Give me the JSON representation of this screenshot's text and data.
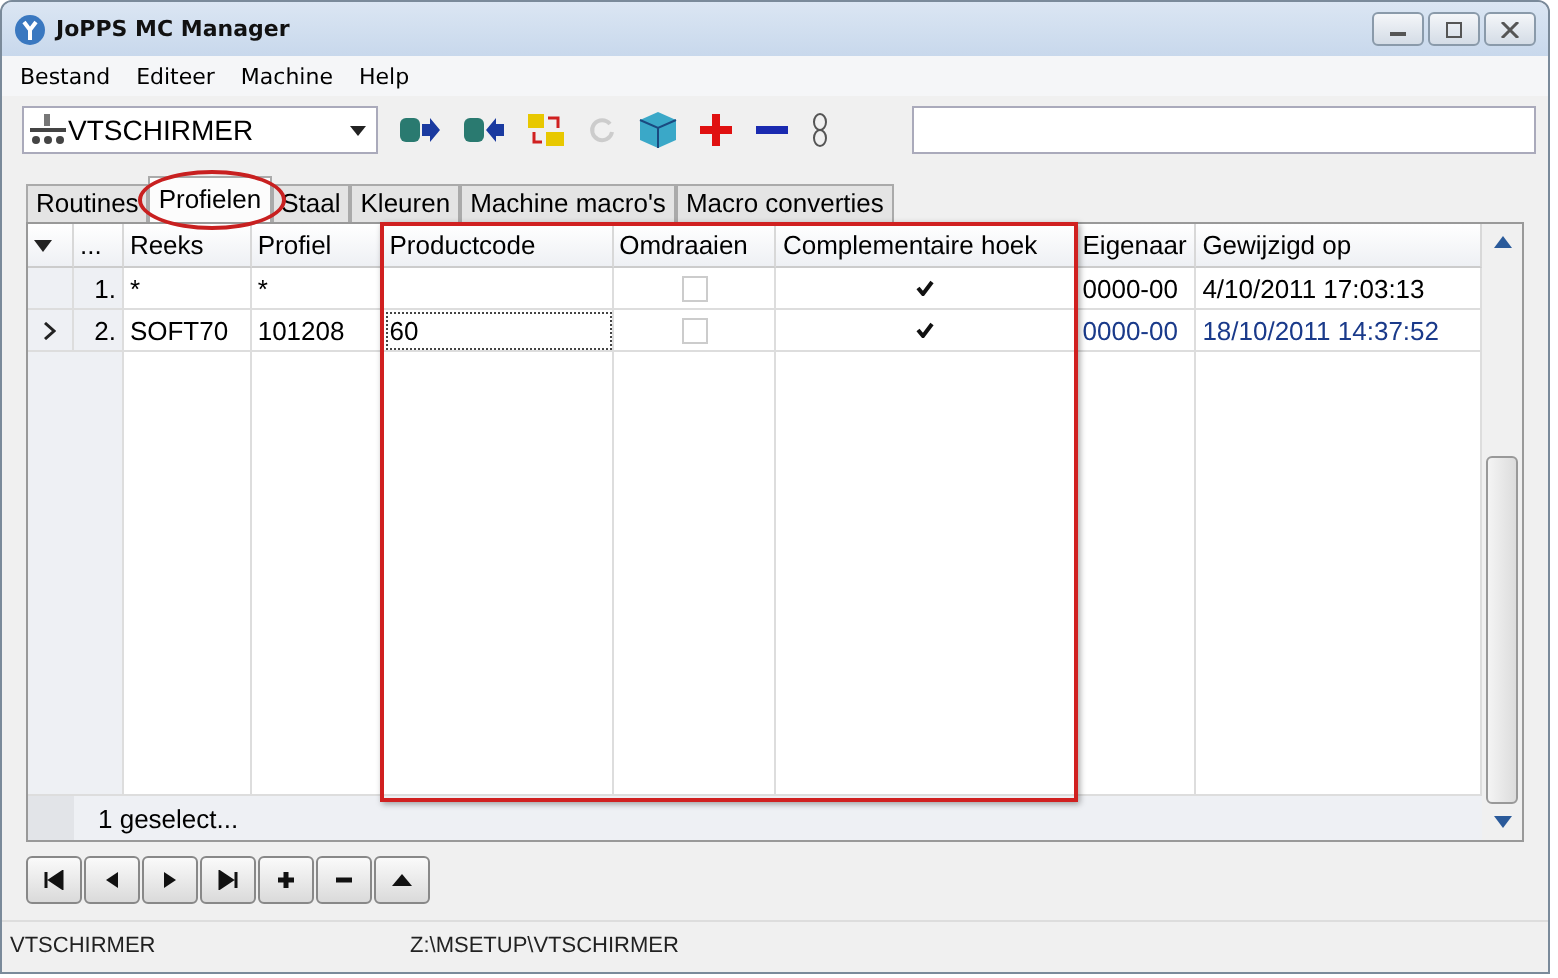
{
  "window": {
    "title": "JoPPS MC Manager"
  },
  "menu": [
    "Bestand",
    "Editeer",
    "Machine",
    "Help"
  ],
  "toolbar": {
    "machine": "VTSCHIRMER"
  },
  "tabs": [
    {
      "label": "Routines",
      "selected": false
    },
    {
      "label": "Profielen",
      "selected": true
    },
    {
      "label": "Staal",
      "selected": false
    },
    {
      "label": "Kleuren",
      "selected": false
    },
    {
      "label": "Machine macro's",
      "selected": false
    },
    {
      "label": "Macro converties",
      "selected": false
    }
  ],
  "table": {
    "columns": [
      "...",
      "Reeks",
      "Profiel",
      "Productcode",
      "Omdraaien",
      "Complementaire hoek",
      "Eigenaar",
      "Gewijzigd op"
    ],
    "rows": [
      {
        "selected": false,
        "number": "1.",
        "reeks": "*",
        "profiel": "*",
        "omdraaien": false,
        "complementaire_hoek": true,
        "eigenaar": "0000-00",
        "gewijzigd_op": "4/10/2011 17:03:13"
      },
      {
        "selected": true,
        "number": "2.",
        "reeks": "SOFT70",
        "profiel": "101208",
        "productcode": "60",
        "omdraaien": false,
        "complementaire_hoek": true,
        "eigenaar": "0000-00",
        "gewijzigd_op": "18/10/2011 14:37:52"
      }
    ],
    "footer": "1 geselect..."
  },
  "status_bar": [
    "VTSCHIRMER",
    "Z:\\MSETUP\\VTSCHIRMER"
  ]
}
